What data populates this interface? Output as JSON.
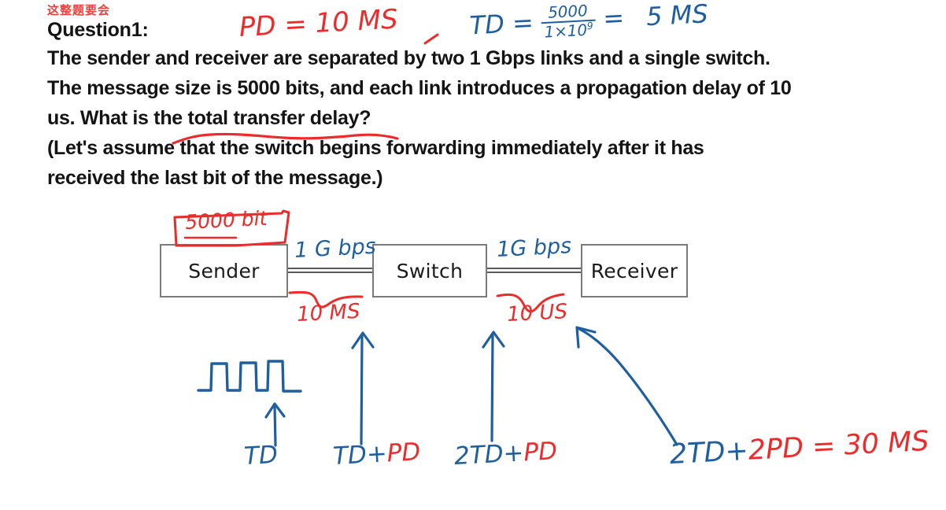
{
  "slide": {
    "chinese_note": "这整题要会",
    "question_label": "Question1:",
    "body_lines": [
      "The sender and receiver are separated by two 1 Gbps links and a single switch.",
      "The message size is 5000 bits, and each link introduces a propagation delay of 10",
      "us. What is the total transfer delay?",
      "(Let's assume that the switch begins forwarding immediately after it has",
      "received the last bit of the message.)"
    ],
    "underlined_phrase": "total transfer delay"
  },
  "diagram": {
    "nodes": [
      {
        "id": "sender",
        "label": "Sender"
      },
      {
        "id": "switch",
        "label": "Switch"
      },
      {
        "id": "receiver",
        "label": "Receiver"
      }
    ],
    "links": [
      {
        "id": "link-1",
        "rate_label": "1 G bps",
        "prop_delay_label": "10 MS"
      },
      {
        "id": "link-2",
        "rate_label": "1G bps",
        "prop_delay_label": "10 US"
      }
    ],
    "message_box_label": "5000 bit"
  },
  "annotations": {
    "pd_formula": "PD = 10 MS",
    "td_formula": {
      "lhs": "TD =",
      "numerator": "5000",
      "denominator": "1×10",
      "denominator_exp": "9",
      "equals": "=",
      "result": "5 MS"
    },
    "timeline_labels": [
      {
        "blue": "TD",
        "red": ""
      },
      {
        "blue": "TD+",
        "red": "PD"
      },
      {
        "blue": "2TD+",
        "red": "PD"
      }
    ],
    "final_equation": {
      "blue": "2TD+",
      "red": "2PD = 30 MS"
    }
  },
  "colors": {
    "ink_red": "#ec2b2b",
    "ink_blue": "#1f5fa0",
    "box_border": "#7a7a7a",
    "text": "#141414"
  }
}
